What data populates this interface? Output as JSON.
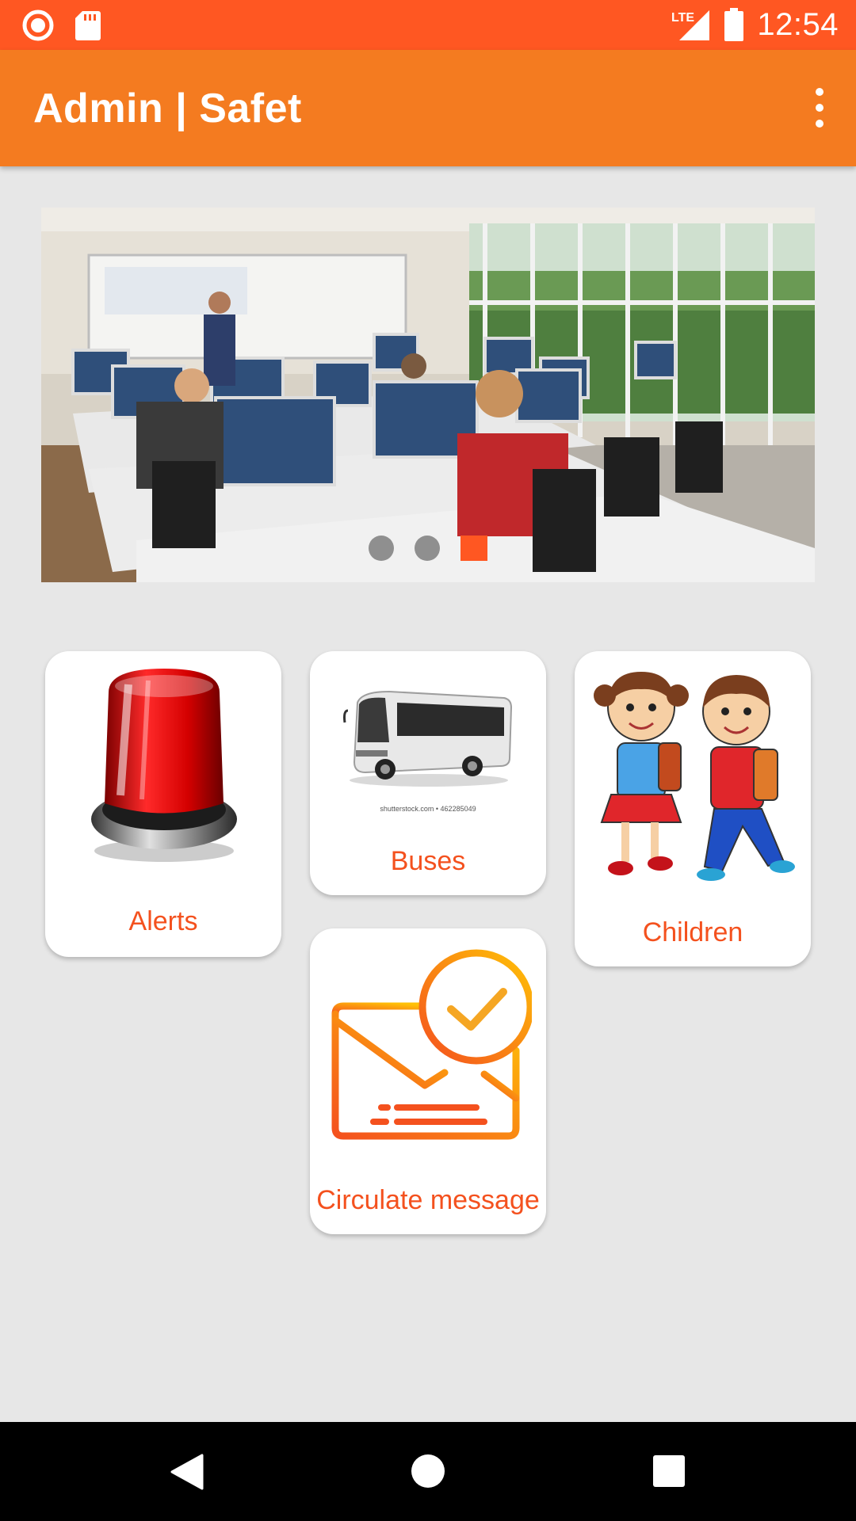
{
  "status_bar": {
    "time": "12:54",
    "network": "LTE",
    "icons": [
      "record-icon",
      "sd-card-icon",
      "signal-icon",
      "battery-icon"
    ],
    "bg_color": "#ff5722"
  },
  "app_bar": {
    "title": "Admin | Safet",
    "menu_icon": "more-vert-icon",
    "bg_color": "#f47b20"
  },
  "banner": {
    "image": "computer-lab-classroom",
    "page_count": 3,
    "active_page": 3,
    "indicator_color": "#ff5722"
  },
  "tiles": [
    {
      "label": "Alerts",
      "icon": "siren-icon"
    },
    {
      "label": "Buses",
      "icon": "bus-icon",
      "watermark": "shutterstock.com • 462285049"
    },
    {
      "label": "Children",
      "icon": "children-icon"
    },
    {
      "label": "Circulate message",
      "icon": "mail-check-icon"
    }
  ],
  "accent_color": "#f4511e",
  "nav_bar": {
    "buttons": [
      "back-icon",
      "home-icon",
      "recents-icon"
    ]
  }
}
